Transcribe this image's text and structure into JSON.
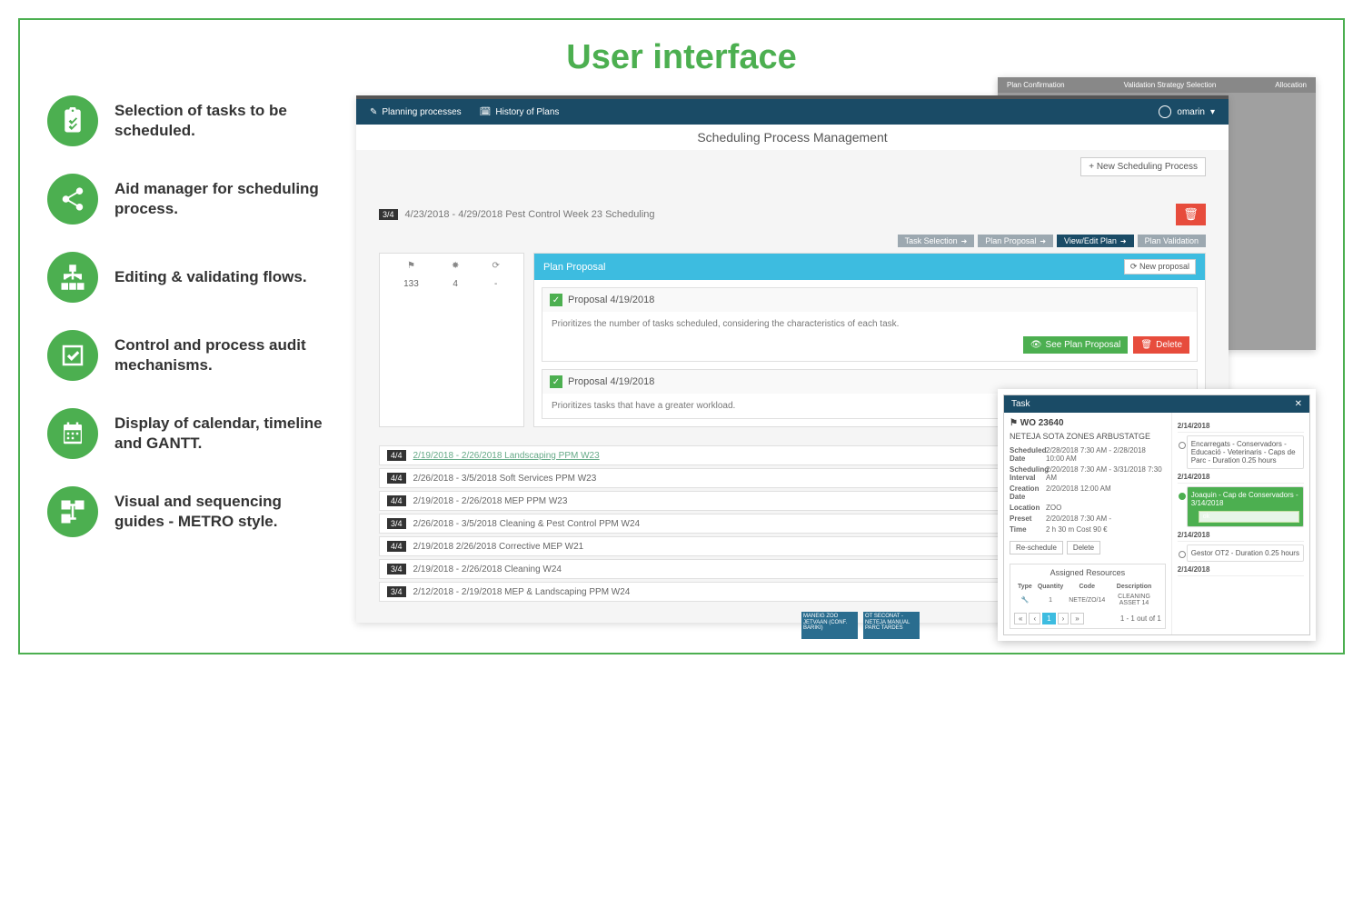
{
  "title": "User interface",
  "features": [
    "Selection of tasks to be scheduled.",
    "Aid manager for scheduling process.",
    "Editing & validating flows.",
    "Control and process audit mechanisms.",
    "Display of calendar, timeline and GANTT.",
    "Visual and sequencing guides - METRO style."
  ],
  "app": {
    "topbar": {
      "planning": "Planning processes",
      "history": "History of Plans",
      "user": "omarin"
    },
    "header": "Scheduling Process Management",
    "new_process_btn": "+ New Scheduling Process",
    "main_process": {
      "badge": "3/4",
      "title": "4/23/2018 - 4/29/2018  Pest Control Week 23 Scheduling"
    },
    "tabs": [
      {
        "label": "Task Selection"
      },
      {
        "label": "Plan Proposal"
      },
      {
        "label": "View/Edit Plan"
      },
      {
        "label": "Plan Validation"
      }
    ],
    "stats": [
      {
        "value": "133"
      },
      {
        "value": "4"
      },
      {
        "value": "-"
      }
    ],
    "plan_proposal": {
      "header": "Plan Proposal",
      "new_btn": "New proposal",
      "cards": [
        {
          "title": "Proposal 4/19/2018",
          "desc": "Prioritizes the number of tasks scheduled, considering the characteristics of each task.",
          "see_btn": "See Plan Proposal",
          "del_btn": "Delete"
        },
        {
          "title": "Proposal 4/19/2018",
          "desc": "Prioritizes tasks that have a greater workload."
        }
      ]
    },
    "process_rows": [
      {
        "badge": "4/4",
        "text": "2/19/2018 - 2/26/2018  Landscaping PPM W23"
      },
      {
        "badge": "4/4",
        "text": "2/26/2018 - 3/5/2018  Soft Services PPM W23"
      },
      {
        "badge": "4/4",
        "text": "2/19/2018 - 2/26/2018  MEP PPM W23"
      },
      {
        "badge": "3/4",
        "text": "2/26/2018 - 3/5/2018  Cleaning & Pest Control PPM W24"
      },
      {
        "badge": "4/4",
        "text": "2/19/2018   2/26/2018  Corrective MEP W21"
      },
      {
        "badge": "3/4",
        "text": "2/19/2018 - 2/26/2018  Cleaning W24"
      },
      {
        "badge": "3/4",
        "text": "2/12/2018 - 2/19/2018  MEP & Landscaping PPM W24"
      }
    ]
  },
  "task_popup": {
    "overlay_tabs": [
      "Plan Confirmation",
      "Validation Strategy Selection",
      "Allocation"
    ],
    "header": "Task",
    "wo": "WO 23640",
    "wo_name": "NETEJA SOTA ZONES ARBUSTATGE",
    "fields": [
      {
        "label": "Scheduled Date",
        "value": "2/28/2018 7:30 AM  -  2/28/2018 10:00 AM"
      },
      {
        "label": "Scheduling Interval",
        "value": "2/20/2018 7:30 AM - 3/31/2018 7:30 AM"
      },
      {
        "label": "Creation Date",
        "value": "2/20/2018 12:00 AM"
      },
      {
        "label": "Location",
        "value": "ZOO"
      },
      {
        "label": "Preset",
        "value": "2/20/2018 7:30 AM  -"
      },
      {
        "label": "Time",
        "value": "2 h 30 m    Cost    90 €"
      }
    ],
    "reschedule_btn": "Re-schedule",
    "delete_btn": "Delete",
    "resources": {
      "title": "Assigned Resources",
      "headers": [
        "Type",
        "Quantity",
        "Code",
        "Description"
      ],
      "row": [
        "",
        "1",
        "NETE/ZO/14",
        "CLEANING ASSET 14"
      ],
      "pager_text": "1 - 1 out of 1"
    },
    "timeline": [
      {
        "date": "2/14/2018",
        "item": "Encarregats - Conservadors - Educació - Veterinaris - Caps de Parc - Duration 0.25 hours"
      },
      {
        "date": "2/14/2018",
        "item": "Joaquin - Cap de Conservadors - 3/14/2018",
        "active": true
      },
      {
        "date": "2/14/2018",
        "item": "Gestor OT2 - Duration 0.25 hours"
      },
      {
        "date": "2/14/2018",
        "item": ""
      }
    ],
    "bluecards": [
      "MANEIG ZOO JETVAAN (CONF. BARIKI)",
      "OT SECONAT - NETEJA MANUAL PARC TARDES"
    ]
  }
}
